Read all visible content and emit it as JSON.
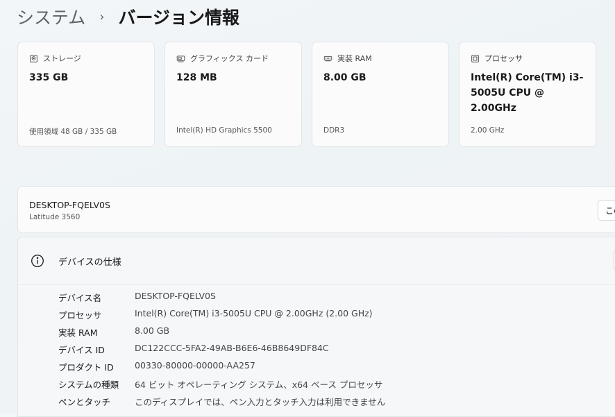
{
  "breadcrumb": {
    "parent": "システム",
    "separator": "›",
    "current": "バージョン情報"
  },
  "cards": [
    {
      "icon": "storage-icon",
      "title": "ストレージ",
      "value": "335 GB",
      "sub": "使用領域 48 GB / 335 GB"
    },
    {
      "icon": "graphics-card-icon",
      "title": "グラフィックス カード",
      "value": "128 MB",
      "sub": "Intel(R) HD Graphics 5500"
    },
    {
      "icon": "ram-icon",
      "title": "実装 RAM",
      "value": "8.00 GB",
      "sub": "DDR3"
    },
    {
      "icon": "processor-icon",
      "title": "プロセッサ",
      "value": "Intel(R) Core(TM) i3-5005U CPU @ 2.00GHz",
      "sub": "2.00 GHz"
    }
  ],
  "device": {
    "name": "DESKTOP-FQELV0S",
    "model": "Latitude 3560",
    "rename_label": "この PC の名前を変更"
  },
  "specs": {
    "title": "デバイスの仕様",
    "rows": [
      {
        "label": "デバイス名",
        "value": "DESKTOP-FQELV0S"
      },
      {
        "label": "プロセッサ",
        "value": "Intel(R) Core(TM) i3-5005U CPU @ 2.00GHz (2.00 GHz)"
      },
      {
        "label": "実装 RAM",
        "value": "8.00 GB"
      },
      {
        "label": "デバイス ID",
        "value": "DC122CCC-5FA2-49AB-B6E6-46B8649DF84C"
      },
      {
        "label": "プロダクト ID",
        "value": "00330-80000-00000-AA257"
      },
      {
        "label": "システムの種類",
        "value": "64 ビット オペレーティング システム、x64 ベース プロセッサ"
      },
      {
        "label": "ペンとタッチ",
        "value": "このディスプレイでは、ペン入力とタッチ入力は利用できません"
      }
    ]
  }
}
